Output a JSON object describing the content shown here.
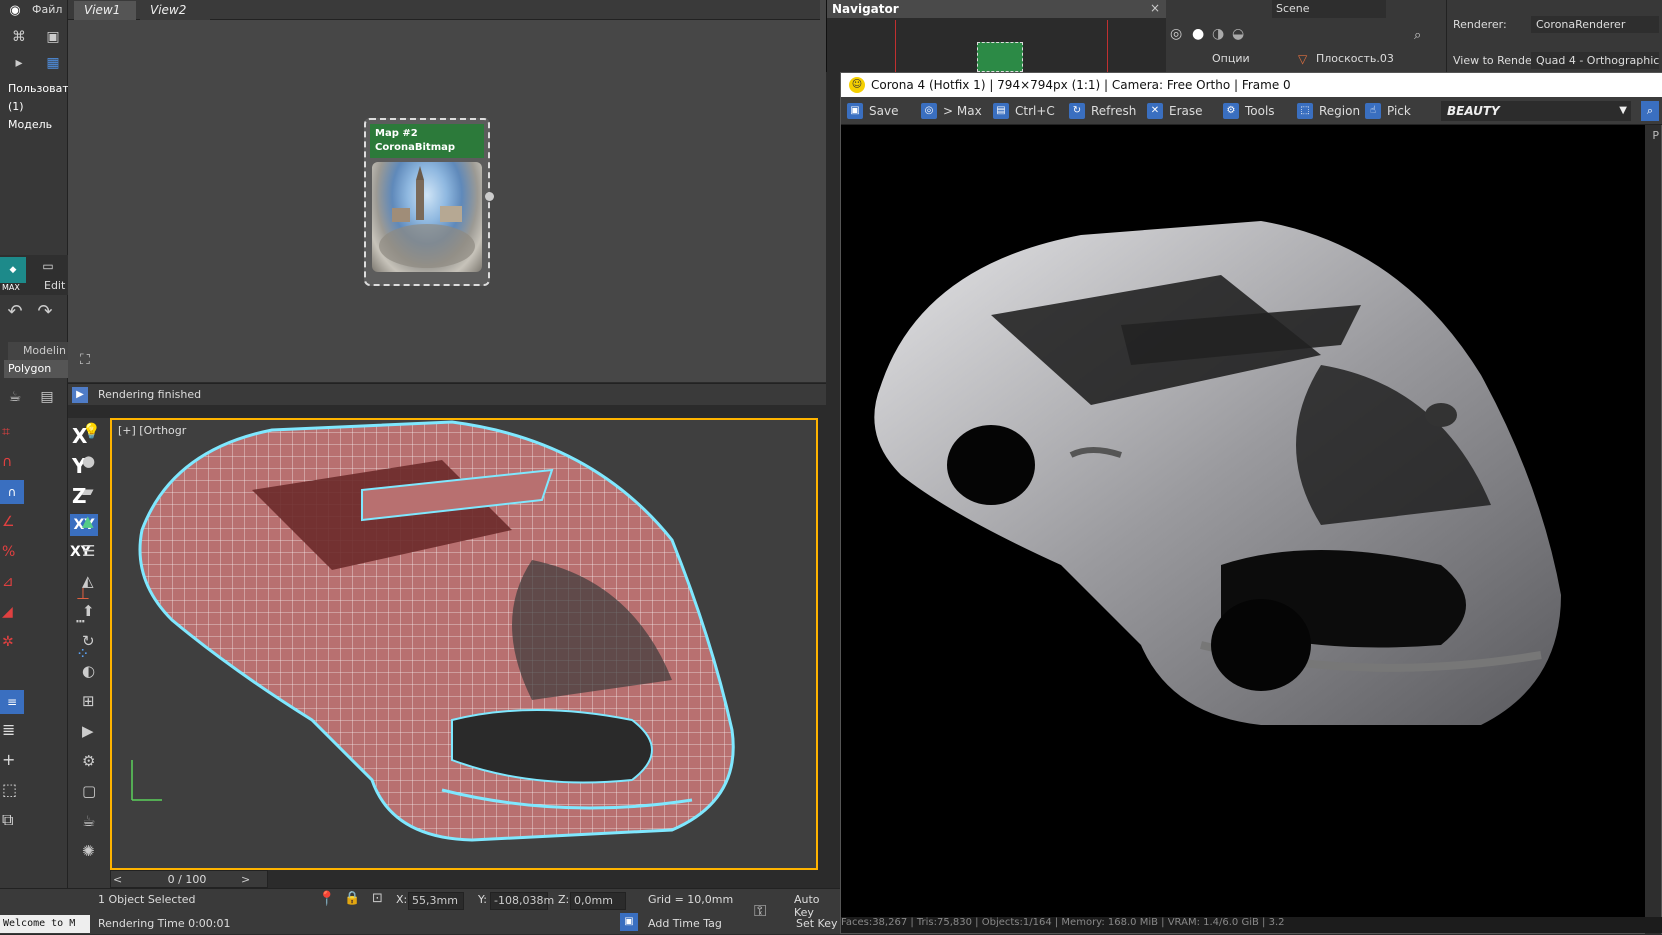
{
  "menu": {
    "file_label": "Файл"
  },
  "views": {
    "tab1": "View1",
    "tab2": "View2"
  },
  "scene_tree": {
    "item1": "Пользовате",
    "item2": "(1) Модель"
  },
  "ribbon": {
    "max_label": "MAX",
    "edit_label": "Edit",
    "modeling_label": "Modelin",
    "polygon_label": "Polygon Mc"
  },
  "node": {
    "title_line1": "Map #2",
    "title_line2": "CoronaBitmap"
  },
  "slate_status": {
    "text": "Rendering finished"
  },
  "viewport": {
    "label": "[+] [Orthogr"
  },
  "axes": {
    "x": "X",
    "y": "Y",
    "z": "Z",
    "xy": "XY",
    "xy2": "XY"
  },
  "timeslider": {
    "value": "0 / 100",
    "prev": "<",
    "next": ">"
  },
  "statusbar": {
    "selection": "1 Object Selected",
    "render_time": "Rendering Time  0:00:01",
    "welcome": "Welcome to M",
    "x_label": "X:",
    "x_value": "55,3mm",
    "y_label": "Y:",
    "y_value": "-108,038m",
    "z_label": "Z:",
    "z_value": "0,0mm",
    "grid": "Grid = 10,0mm",
    "add_time_tag": "Add Time Tag",
    "auto_key": "Auto Key",
    "set_key": "Set Key"
  },
  "navigator": {
    "title": "Navigator",
    "close": "×"
  },
  "scene_panel": {
    "scene_label": "Scene",
    "options_label": "Опции",
    "plane_label": "Плоскость.03"
  },
  "renderer": {
    "renderer_label": "Renderer:",
    "renderer_value": "CoronaRenderer",
    "view_label": "View to Render:",
    "view_value": "Quad 4 - Orthographic"
  },
  "vfb": {
    "title": "Corona 4 (Hotfix 1) | 794×794px (1:1) | Camera: Free Ortho | Frame 0",
    "save": "Save",
    "to_max": "> Max",
    "ctrl_c": "Ctrl+C",
    "refresh": "Refresh",
    "erase": "Erase",
    "tools": "Tools",
    "region": "Region",
    "pick": "Pick",
    "beauty": "BEAUTY",
    "footer": "Faces:38,267 | Tris:75,830 | Objects:1/164 | Memory: 168.0 MiB | VRAM: 1.4/6.0 GiB | 3.2"
  },
  "colors": {
    "accent_blue": "#3a6fc0",
    "node_green": "#2c7a3a",
    "viewport_border": "#ffb400",
    "wire_cyan": "#7fe8ff",
    "mesh_red": "#b87070"
  }
}
